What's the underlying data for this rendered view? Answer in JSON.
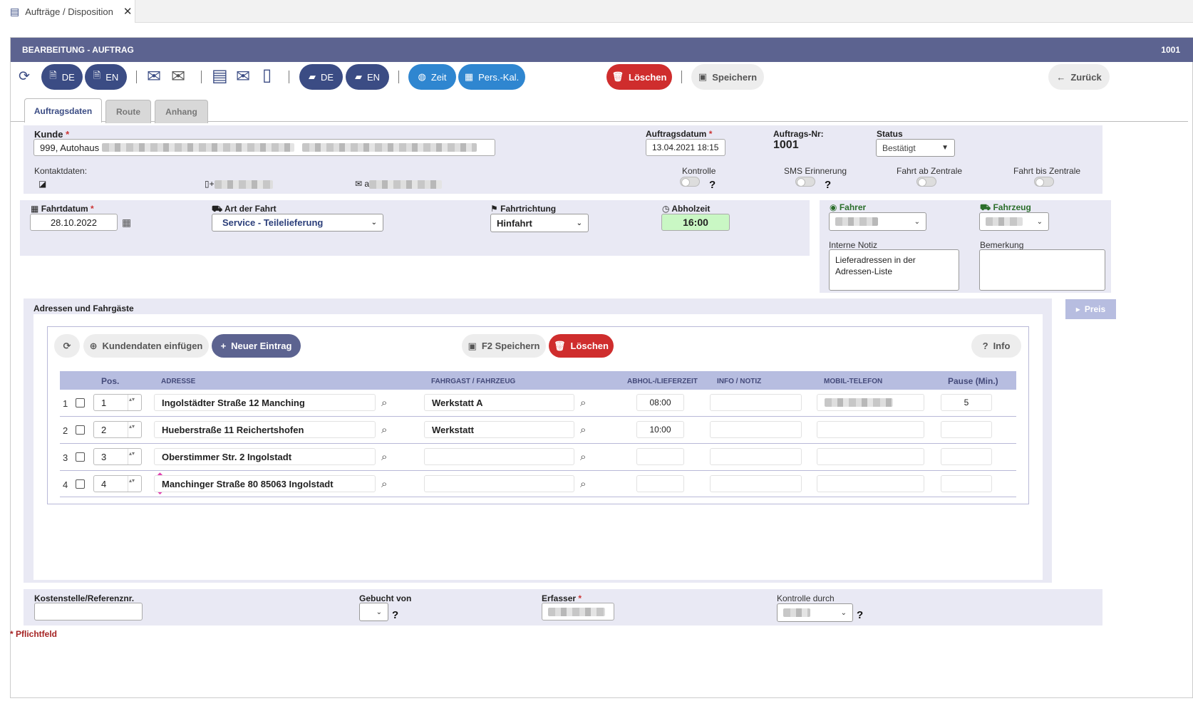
{
  "window_tab": {
    "label": "Aufträge / Disposition"
  },
  "header": {
    "title": "BEARBEITUNG - AUFTRAG",
    "order_id": "1001"
  },
  "toolbar": {
    "pdf_de": "DE",
    "pdf_en": "EN",
    "chat_de": "DE",
    "chat_en": "EN",
    "zeit": "Zeit",
    "pers_kal": "Pers.-Kal.",
    "loeschen": "Löschen",
    "speichern": "Speichern",
    "zurueck": "Zurück"
  },
  "tabs": [
    "Auftragsdaten",
    "Route",
    "Anhang"
  ],
  "kunde": {
    "label": "Kunde",
    "value": "999, Autohaus"
  },
  "kontaktdaten": {
    "label": "Kontaktdaten:",
    "phone_prefix": "+",
    "email_prefix": "a"
  },
  "auftragsdatum": {
    "label": "Auftragsdatum",
    "value": "13.04.2021 18:15"
  },
  "auftrags_nr": {
    "label": "Auftrags-Nr:",
    "value": "1001"
  },
  "status": {
    "label": "Status",
    "value": "Bestätigt"
  },
  "toggles": {
    "kontrolle": "Kontrolle",
    "sms": "SMS Erinnerung",
    "fahrt_ab": "Fahrt ab Zentrale",
    "fahrt_bis": "Fahrt bis Zentrale",
    "help": "?"
  },
  "fahrtdatum": {
    "label": "Fahrtdatum",
    "value": "28.10.2022"
  },
  "art_der_fahrt": {
    "label": "Art der Fahrt",
    "value": "Service - Teilelieferung"
  },
  "fahrtrichtung": {
    "label": "Fahrtrichtung",
    "value": "Hinfahrt"
  },
  "abholzeit": {
    "label": "Abholzeit",
    "value": "16:00"
  },
  "fahrer": {
    "label": "Fahrer"
  },
  "fahrzeug": {
    "label": "Fahrzeug"
  },
  "interne_notiz": {
    "label": "Interne Notiz",
    "value": "Lieferadressen in der Adressen-Liste"
  },
  "bemerkung": {
    "label": "Bemerkung",
    "value": ""
  },
  "adressen": {
    "title": "Adressen und Fahrgäste",
    "preis": "Preis",
    "buttons": {
      "kundendaten": "Kundendaten einfügen",
      "neu": "Neuer Eintrag",
      "f2": "F2 Speichern",
      "loeschen": "Löschen",
      "info": "Info"
    },
    "columns": {
      "pos": "Pos.",
      "adresse": "ADRESSE",
      "fahrgast": "FAHRGAST / FAHRZEUG",
      "zeit": "ABHOL-/LIEFERZEIT",
      "info": "INFO / NOTIZ",
      "mobil": "MOBIL-TELEFON",
      "pause": "Pause (Min.)"
    },
    "rows": [
      {
        "num": "1",
        "pos": "1",
        "adresse": "Ingolstädter Straße 12 Manching",
        "fahrgast": "Werkstatt A",
        "zeit": "08:00",
        "pause": "5"
      },
      {
        "num": "2",
        "pos": "2",
        "adresse": "Hueberstraße 11 Reichertshofen",
        "fahrgast": "Werkstatt",
        "zeit": "10:00",
        "pause": ""
      },
      {
        "num": "3",
        "pos": "3",
        "adresse": "Oberstimmer Str. 2 Ingolstadt",
        "fahrgast": "",
        "zeit": "",
        "pause": ""
      },
      {
        "num": "4",
        "pos": "4",
        "adresse": "Manchinger Straße 80 85063  Ingolstadt",
        "fahrgast": "",
        "zeit": "",
        "pause": ""
      }
    ]
  },
  "footer": {
    "kostenstelle": "Kostenstelle/Referenznr.",
    "gebucht_von": "Gebucht von",
    "erfasser": "Erfasser",
    "kontrolle_durch": "Kontrolle durch",
    "pflichtfeld": "* Pflichtfeld",
    "help": "?"
  },
  "colors": {
    "header": "#5c6390",
    "navy": "#3b4c84",
    "blue": "#2f86d0",
    "red": "#cf2d2d",
    "panel": "#e9e9f4"
  }
}
